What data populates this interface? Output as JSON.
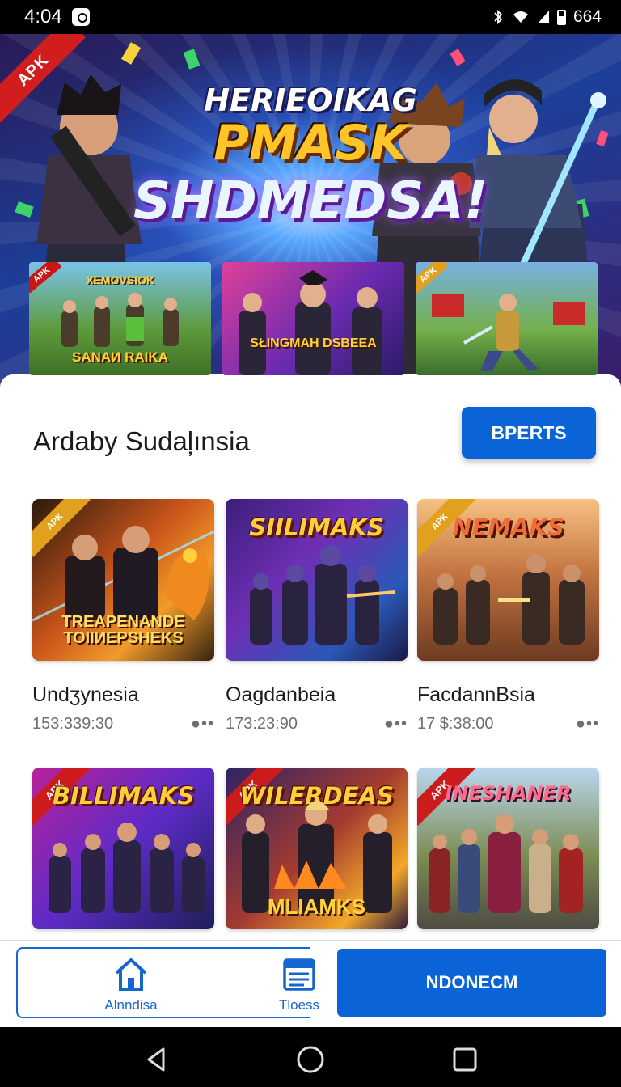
{
  "status_bar": {
    "time": "4:04",
    "battery": "664",
    "icons": [
      "notification-icon",
      "bluetooth-icon",
      "wifi-icon",
      "signal-icon",
      "battery-icon"
    ]
  },
  "hero": {
    "ribbon": "APK",
    "title_line1": "HERIEOIKAG",
    "title_line2": "PMASK",
    "title_line3": "SHDMEDSA!",
    "thumbnails": [
      {
        "tag": "APK",
        "text_top": "ХЕМОVSIOK",
        "text_bottom": "SANAИ RAIKA"
      },
      {
        "tag": "",
        "text_top": "",
        "text_bottom": "SŁINGMAH DSBEEA"
      },
      {
        "tag": "APK",
        "text_top": "",
        "text_bottom": ""
      }
    ]
  },
  "section": {
    "title": "Ardaby Sudaļınsia",
    "button_label": "BPERTS"
  },
  "games": [
    {
      "name": "Undʒynesia",
      "meta": "153:339:30",
      "tag": "APK",
      "art_title": "",
      "art_bottom": "TREAPENANDE ТОІІИEPSHEKS"
    },
    {
      "name": "Oagdanbeia",
      "meta": "173:23:90",
      "tag": "",
      "art_title": "SIILIMAKS",
      "art_bottom": ""
    },
    {
      "name": "FacdannBsia",
      "meta": "17 $:38:00",
      "tag": "APK",
      "art_title": "NEMAKS",
      "art_bottom": ""
    },
    {
      "tag": "APK",
      "art_title": "BILLIMAKS",
      "art_bottom": ""
    },
    {
      "tag": "APK",
      "art_title": "WILERDEAS",
      "art_bottom": "MLIAMKS"
    },
    {
      "tag": "APK",
      "art_title": "INESHANER",
      "art_bottom": ""
    }
  ],
  "bottom_nav": {
    "tabs": [
      {
        "label": "Alnndisa",
        "icon": "home-icon"
      },
      {
        "label": "Tloess",
        "icon": "list-icon"
      }
    ],
    "primary_label": "NDONECM"
  },
  "system_nav": {
    "icons": [
      "back-icon",
      "home-circle-icon",
      "recents-icon"
    ]
  },
  "colors": {
    "primary": "#0a63d7",
    "tab_blue": "#1466d0",
    "ribbon_red": "#d11d1d",
    "title_gold": "#ffc528"
  }
}
